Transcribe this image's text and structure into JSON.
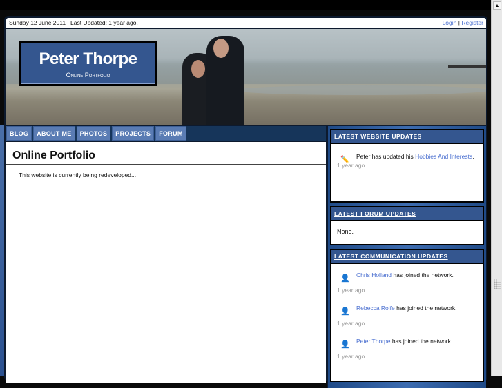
{
  "topbar": {
    "date_text": "Sunday 12 June 2011 | Last Updated: 1 year ago.",
    "login": "Login",
    "separator": "|",
    "register": "Register"
  },
  "header": {
    "title": "Peter Thorpe",
    "subtitle": "Online Portfolio"
  },
  "nav": [
    {
      "label": "BLOG"
    },
    {
      "label": "ABOUT ME"
    },
    {
      "label": "PHOTOS"
    },
    {
      "label": "PROJECTS"
    },
    {
      "label": "FORUM"
    }
  ],
  "main": {
    "title": "Online Portfolio",
    "body": "This website is currently being redeveloped..."
  },
  "sidebar": {
    "website": {
      "title": "LATEST WEBSITE UPDATES",
      "text": "Peter has updated his ",
      "link": "Hobbies And Interests",
      "suffix": ".",
      "time": "1 year ago."
    },
    "forum": {
      "title": "LATEST FORUM UPDATES",
      "text": "None."
    },
    "communication": {
      "title": "LATEST COMMUNICATION UPDATES",
      "items": [
        {
          "name": "Chris Holland",
          "text": " has joined the network.",
          "time": "1 year ago."
        },
        {
          "name": "Rebecca Rolfe",
          "text": " has joined the network.",
          "time": "1 year ago."
        },
        {
          "name": "Peter Thorpe",
          "text": " has joined the network.",
          "time": "1 year ago."
        }
      ]
    }
  }
}
